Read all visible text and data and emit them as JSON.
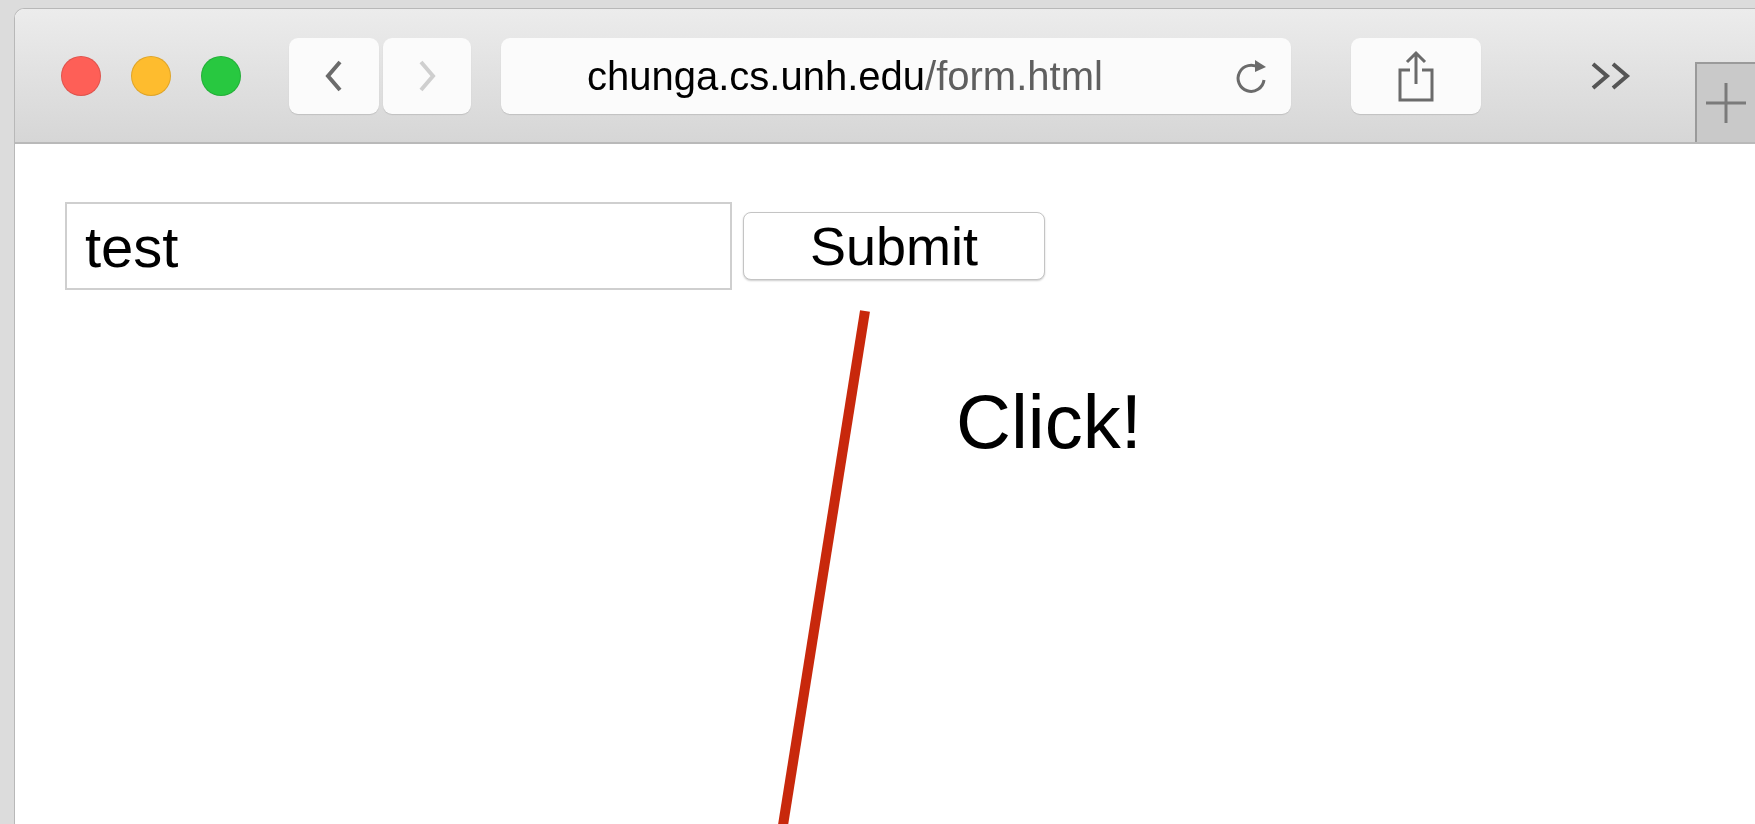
{
  "window": {
    "traffic_lights": [
      {
        "color": "#fe5f57"
      },
      {
        "color": "#febc2e"
      },
      {
        "color": "#28c840"
      }
    ]
  },
  "toolbar": {
    "nav_buttons": [
      {
        "kind": "back",
        "disabled": false
      },
      {
        "kind": "forward",
        "disabled": true
      }
    ],
    "address": {
      "host": "chunga.cs.unh.edu",
      "path": "/form.html"
    }
  },
  "page": {
    "text_field": {
      "value": "test"
    },
    "submit_button": {
      "label": "Submit"
    }
  },
  "annotation": {
    "text": "Click!"
  }
}
